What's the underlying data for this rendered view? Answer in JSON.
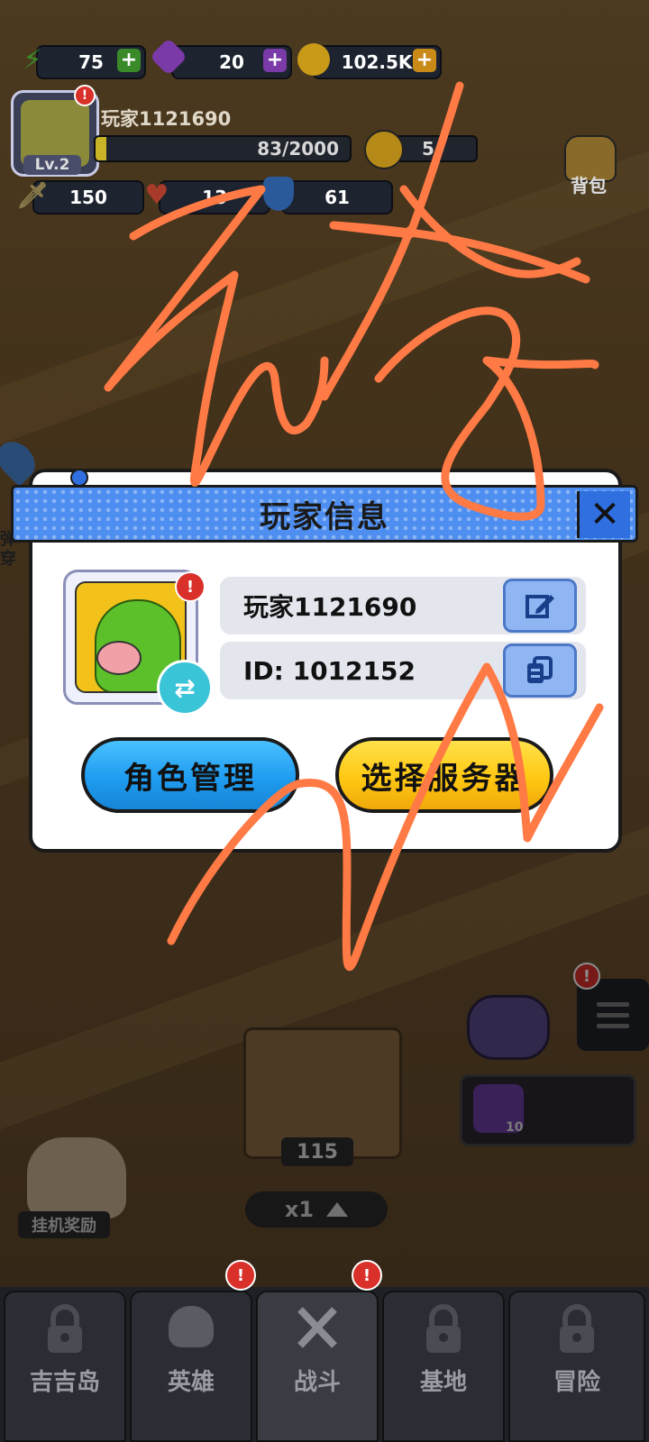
{
  "colors": {
    "accent_blue": "#4d8ef0",
    "accent_yellow": "#ffc812",
    "accent_cyan": "#1f9cf0",
    "alert_red": "#d9302a",
    "scribble": "#ff7a45"
  },
  "hud": {
    "energy": "75",
    "gems": "20",
    "coins": "102.5K",
    "player_name": "玩家1121690",
    "level": "Lv.2",
    "xp": "83/2000",
    "power": "5",
    "attack": "150",
    "hp": "13",
    "defense": "61",
    "bag_label": "背包"
  },
  "dialog": {
    "title": "玩家信息",
    "name_value": "玩家1121690",
    "id_value": "ID: 1012152",
    "role_button": "角色管理",
    "server_button": "选择服务器"
  },
  "side": {
    "left_text": "弹穿",
    "chest_count": "115",
    "speed": "x1",
    "idle_reward": "挂机奖励",
    "gem_count": "10"
  },
  "nav": {
    "tabs": [
      {
        "label": "吉吉岛"
      },
      {
        "label": "英雄"
      },
      {
        "label": "战斗"
      },
      {
        "label": "基地"
      },
      {
        "label": "冒险"
      }
    ]
  },
  "icons": [
    "lightning-icon",
    "gem-icon",
    "coin-icon",
    "sword-icon",
    "heart-icon",
    "shield-icon",
    "fist-icon",
    "backpack-icon",
    "edit-icon",
    "copy-icon",
    "swap-icon",
    "lock-icon",
    "close-icon",
    "gamepad-icon",
    "menu-icon"
  ]
}
